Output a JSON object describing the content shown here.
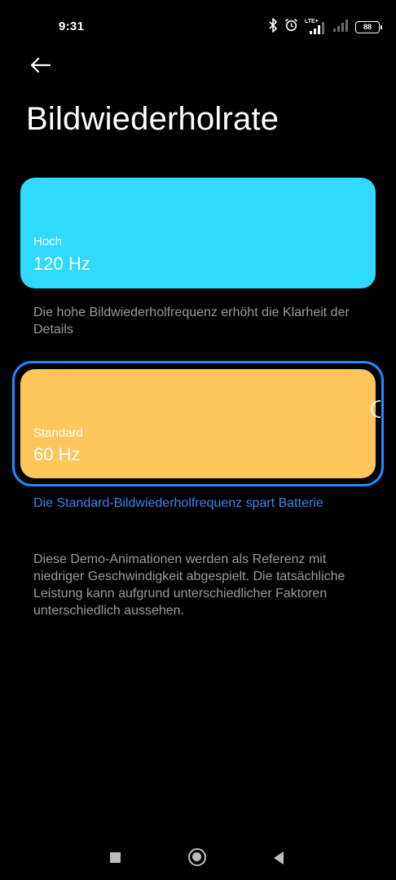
{
  "status_bar": {
    "time": "9:31",
    "network_label": "LTE+",
    "battery_level": "88",
    "icons": [
      "bluetooth-icon",
      "alarm-icon",
      "signal-icon",
      "signal-icon",
      "battery-icon"
    ]
  },
  "header": {
    "back_icon": "arrow-left-icon",
    "title": "Bildwiederholrate"
  },
  "options": [
    {
      "label": "Hoch",
      "value": "120 Hz",
      "description": "Die hohe Bildwiederholfrequenz erhöht die Klarheit der Details",
      "color": "#2fd9ff",
      "selected": false
    },
    {
      "label": "Standard",
      "value": "60 Hz",
      "description": "Die Standard-Bildwiederholfrequenz spart Batterie",
      "color": "#ffc65c",
      "selected": true
    }
  ],
  "demo_note": "Diese Demo-Animationen werden als Referenz mit niedriger Geschwindigkeit abgespielt. Die tatsächliche Leistung kann aufgrund unterschiedlicher Faktoren unterschiedlich aussehen.",
  "colors": {
    "accent": "#1f8bff",
    "selected_text": "#2f86f6",
    "secondary_text": "#9a9a9a",
    "background": "#000000"
  },
  "nav_bar": {
    "icons": [
      "recent-apps-icon",
      "home-icon",
      "back-icon"
    ]
  }
}
